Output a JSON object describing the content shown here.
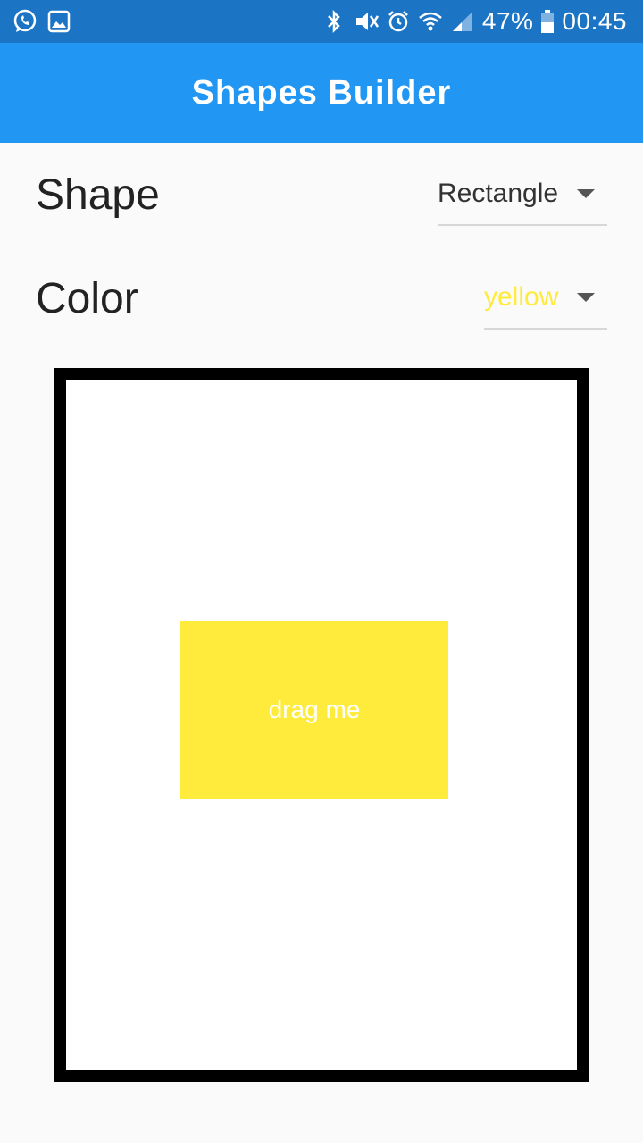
{
  "status_bar": {
    "battery": "47%",
    "time": "00:45",
    "icons_left": [
      "whatsapp-icon",
      "gallery-icon"
    ],
    "icons_right": [
      "bluetooth-icon",
      "mute-icon",
      "alarm-icon",
      "wifi-icon",
      "signal-icon",
      "battery-icon"
    ]
  },
  "app_bar": {
    "title": "Shapes Builder",
    "color": "#2196f3"
  },
  "controls": {
    "shape": {
      "label": "Shape",
      "value": "Rectangle"
    },
    "color": {
      "label": "Color",
      "value": "yellow",
      "value_color": "#ffeb3b"
    }
  },
  "canvas": {
    "shape": {
      "type": "Rectangle",
      "color": "#ffeb3b",
      "label": "drag me"
    }
  }
}
